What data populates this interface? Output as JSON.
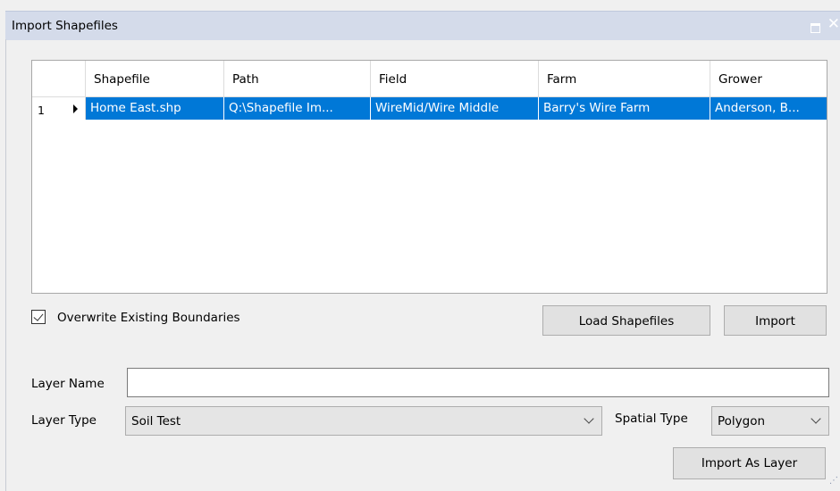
{
  "window": {
    "title": "Import Shapefiles"
  },
  "grid": {
    "columns": [
      "Shapefile",
      "Path",
      "Field",
      "Farm",
      "Grower"
    ],
    "rows": [
      {
        "number": "1",
        "cells": [
          "Home East.shp",
          "Q:\\Shapefile Im...",
          "WireMid/Wire Middle",
          "Barry's Wire Farm",
          "Anderson, B..."
        ]
      }
    ]
  },
  "options": {
    "overwrite_label": "Overwrite Existing Boundaries",
    "overwrite_checked": true
  },
  "buttons": {
    "load_shapefiles": "Load Shapefiles",
    "import": "Import",
    "import_as_layer": "Import As Layer"
  },
  "layer": {
    "name_label": "Layer Name",
    "name_value": "",
    "type_label": "Layer Type",
    "type_value": "Soil Test",
    "spatial_type_label": "Spatial Type",
    "spatial_type_value": "Polygon"
  },
  "colors": {
    "selection": "#0078d7",
    "title_bar": "#d4dbea"
  }
}
